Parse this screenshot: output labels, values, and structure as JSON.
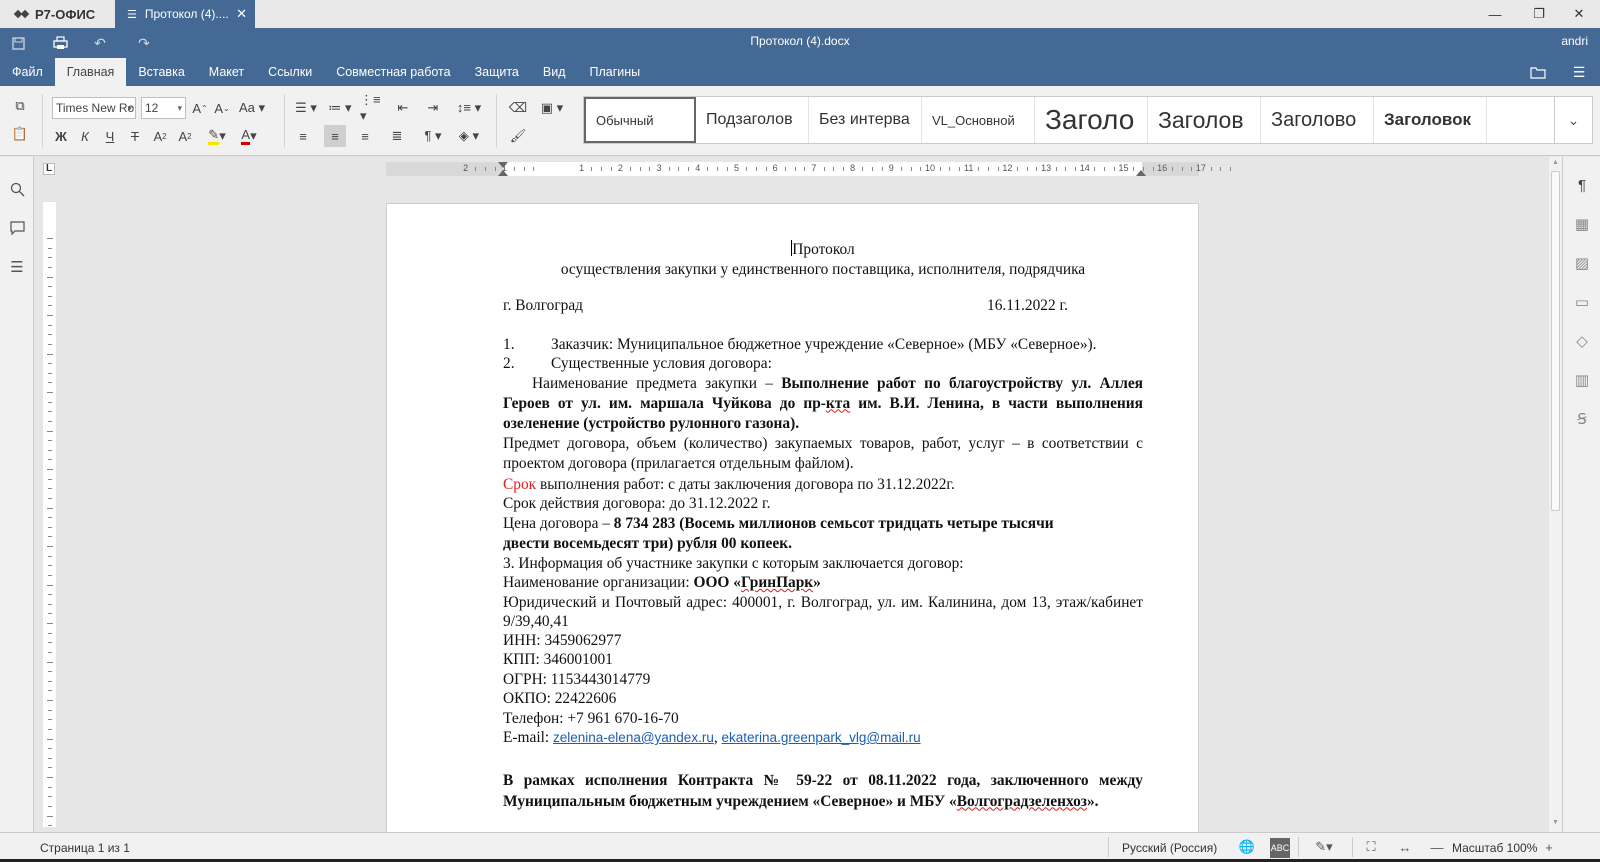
{
  "app": {
    "logo_text": "Р7-ОФИС",
    "tab_title": "Протокол (4)....",
    "doc_title": "Протокол (4).docx",
    "user": "andri",
    "accent": "#446995"
  },
  "menu": [
    "Файл",
    "Главная",
    "Вставка",
    "Макет",
    "Ссылки",
    "Совместная работа",
    "Защита",
    "Вид",
    "Плагины"
  ],
  "toolbar": {
    "font_name": "Times New Ro",
    "font_size": "12"
  },
  "styles": [
    "Обычный",
    "Подзаголов",
    "Без интерва",
    "VL_Основной",
    "Заголо",
    "Заголов",
    "Заголово",
    "Заголовок"
  ],
  "ruler": {
    "numbers": [
      "2",
      "1",
      "1",
      "2",
      "3",
      "4",
      "5",
      "6",
      "7",
      "8",
      "9",
      "10",
      "11",
      "12",
      "13",
      "14",
      "15",
      "16",
      "17"
    ]
  },
  "document": {
    "title": "Протокол",
    "subtitle": "осуществления закупки у единственного поставщика, исполнителя, подрядчика",
    "city": "г. Волгоград",
    "date": "16.11.2022 г.",
    "item1_num": "1.",
    "item1": "Заказчик: Муниципальное бюджетное учреждение «Северное» (МБУ «Северное»).",
    "item2_num": "2.",
    "item2": "Существенные условия договора:",
    "subject_label": "Наименование предмета закупки – ",
    "subject_1": "Выполнение работ по благоустройству ул. Аллея Героев от ул. им. маршала Чуйкова до пр-",
    "subject_wavy": "кта",
    "subject_2": " им. В.И. Ленина, в части выполнения озеленение (устройство рулонного газона).",
    "contract_subject": "Предмет договора, объем (количество) закупаемых товаров, работ, услуг – в соответствии с проектом договора (прилагается отдельным файлом).",
    "term_red": "Срок",
    "term_rest": " выполнения работ: с даты заключения договора по 31.12.2022г.",
    "validity": "Срок действия договора: до 31.12.2022 г.",
    "price_label": "Цена договора – ",
    "price_value": "8 734 283 (Восемь миллионов семьсот тридцать четыре тысячи двести восемьдесят три) рубля 00 копеек.",
    "section3": "3. Информация об участнике закупки с которым заключается договор:",
    "org_label": "Наименование организации: ",
    "org_prefix": "ООО «",
    "org_name": "ГринПарк",
    "org_suffix": "»",
    "address": "Юридический и Почтовый адрес: 400001, г. Волгоград, ул. им. Калинина, дом 13, этаж/кабинет 9/39,40,41",
    "inn": "ИНН: 3459062977",
    "kpp": "КПП: 346001001",
    "ogrn": "ОГРН: 1153443014779",
    "okpo": "ОКПО: 22422606",
    "phone": "Телефон: +7 961 670-16-70",
    "email_label": "E-mail: ",
    "email1": "zelenina-elena@yandex.ru",
    "email_sep": ", ",
    "email2": "ekaterina.greenpark_vlg@mail.ru",
    "final_1": "В рамках исполнения Контракта №  59-22 от 08.11.2022 года, заключенного  между Муниципальным бюджетным учреждением «Северное» и МБУ «",
    "final_wavy": "Волгоградзеленхоз",
    "final_2": "»."
  },
  "status": {
    "page": "Страница 1 из 1",
    "language": "Русский (Россия)",
    "zoom": "Масштаб 100%"
  }
}
